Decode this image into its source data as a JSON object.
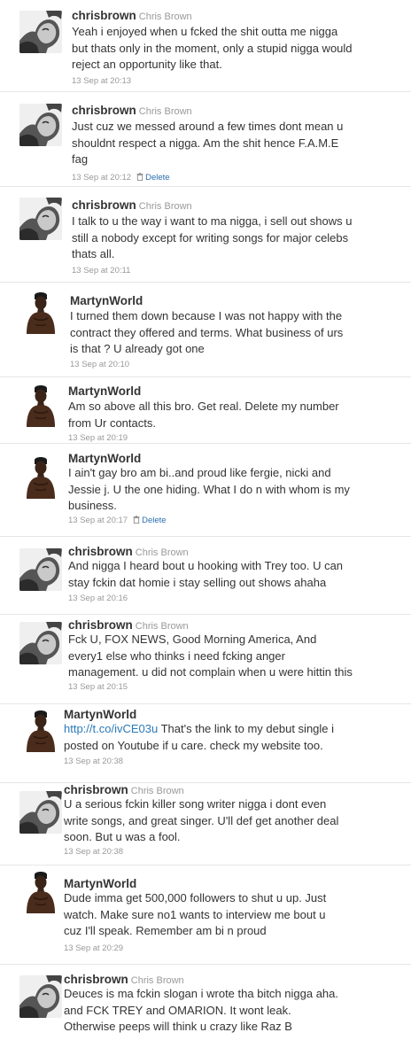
{
  "tweets": [
    {
      "user": "chrisbrown",
      "full_name": "Chris Brown",
      "avatar": "cb",
      "lines": [
        "Yeah i enjoyed when u fcked the shit outta me nigga",
        "but thats only in the moment, only a stupid nigga would",
        "reject an opportunity like that."
      ],
      "time": "13 Sep at 20:13",
      "delete": ""
    },
    {
      "user": "chrisbrown",
      "full_name": "Chris Brown",
      "avatar": "cb",
      "lines": [
        "Just cuz we messed around a few times dont mean u",
        "shouldnt respect a nigga. Am the shit hence F.A.M.E",
        "fag"
      ],
      "time": "13 Sep at 20:12",
      "delete": "Delete"
    },
    {
      "user": "chrisbrown",
      "full_name": "Chris Brown",
      "avatar": "cb",
      "lines": [
        "I talk to u the way i want to ma nigga, i sell out shows u",
        "still a nobody except for writing songs for major celebs",
        "thats all."
      ],
      "time": "13 Sep at 20:11",
      "delete": ""
    },
    {
      "user": "MartynWorld",
      "full_name": "",
      "avatar": "mw",
      "lines": [
        "I turned them down because I was not happy with the",
        "contract they offered and terms. What business of urs",
        "is that ? U already got one"
      ],
      "time": "13 Sep at 20:10",
      "delete": ""
    },
    {
      "user": "MartynWorld",
      "full_name": "",
      "avatar": "mw",
      "lines": [
        "Am so above all this bro. Get real. Delete my number",
        "from Ur contacts."
      ],
      "time": "13 Sep at 20:19",
      "delete": ""
    },
    {
      "user": "MartynWorld",
      "full_name": "",
      "avatar": "mw",
      "lines": [
        "I ain't gay bro am bi..and proud like fergie, nicki and",
        "Jessie j. U the one hiding. What I do n with whom is my",
        "business."
      ],
      "time": "13 Sep at 20:17",
      "delete": "Delete"
    },
    {
      "user": "chrisbrown",
      "full_name": "Chris Brown",
      "avatar": "cb",
      "lines": [
        "And nigga I heard bout u hooking with Trey too. U can",
        "stay fckin dat homie i stay selling out shows ahaha"
      ],
      "time": "13 Sep at 20:16",
      "delete": ""
    },
    {
      "user": "chrisbrown",
      "full_name": "Chris Brown",
      "avatar": "cb",
      "lines": [
        "Fck U, FOX NEWS, Good Morning America, And",
        "every1 else who thinks i need fcking anger",
        "management. u did not complain when u were hittin this"
      ],
      "time": "13 Sep at 20:15",
      "delete": ""
    },
    {
      "user": "MartynWorld",
      "full_name": "",
      "avatar": "mw",
      "link": "http://t.co/ivCE03u",
      "lines": [
        " That's the link to my debut single i",
        "posted on Youtube if u care. check my website too."
      ],
      "time": "13 Sep at 20:38",
      "delete": ""
    },
    {
      "user": "chrisbrown",
      "full_name": "Chris Brown",
      "avatar": "cb",
      "lines": [
        "U a serious fckin killer song writer nigga i dont even",
        "write songs, and great singer. U'll def get another deal",
        "soon. But u was a fool."
      ],
      "time": "13 Sep at 20:38",
      "delete": ""
    },
    {
      "user": "MartynWorld",
      "full_name": "",
      "avatar": "mw",
      "lines": [
        "Dude imma get 500,000 followers to shut u up. Just",
        "watch. Make sure no1 wants to interview me bout u",
        "cuz I'll speak. Remember am bi n proud"
      ],
      "time": "13 Sep at 20:29",
      "delete": ""
    },
    {
      "user": "chrisbrown",
      "full_name": "Chris Brown",
      "avatar": "cb",
      "lines": [
        "Deuces is ma fckin slogan i wrote tha bitch nigga aha.",
        "and FCK TREY and OMARION. It wont leak.",
        "Otherwise peeps will think u crazy like Raz B"
      ],
      "time": "",
      "delete": ""
    }
  ]
}
